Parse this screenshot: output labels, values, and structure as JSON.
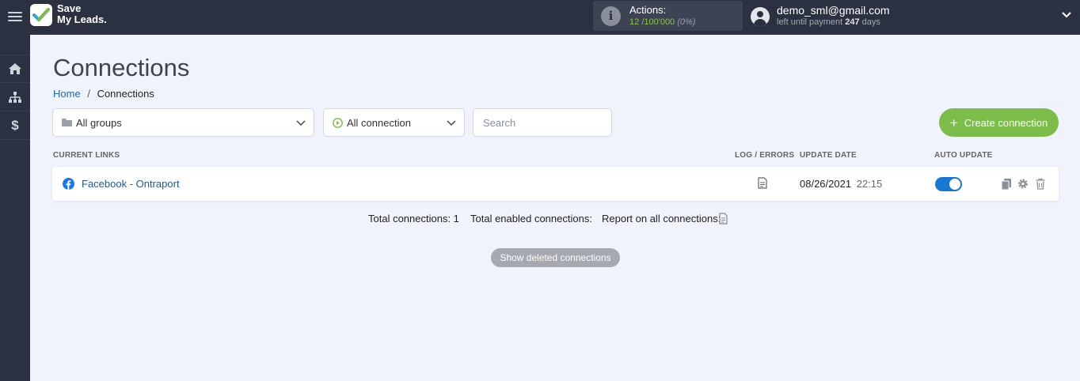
{
  "brand": {
    "line1": "Save",
    "line2": "My Leads."
  },
  "actions": {
    "label": "Actions:",
    "used": "12",
    "total": "/100'000",
    "percent": "(0%)"
  },
  "user": {
    "email": "demo_sml@gmail.com",
    "payment_prefix": "left until payment",
    "payment_days": "247",
    "payment_suffix": "days"
  },
  "sidebar": {
    "items": [
      {
        "icon": "home-icon"
      },
      {
        "icon": "sitemap-icon"
      },
      {
        "icon": "dollar-icon",
        "glyph": "$"
      }
    ]
  },
  "page": {
    "title": "Connections"
  },
  "breadcrumb": {
    "home": "Home",
    "separator": "/",
    "current": "Connections"
  },
  "filters": {
    "groups": "All groups",
    "connection": "All connection",
    "search_placeholder": "Search"
  },
  "create_button": {
    "label": "Create connection"
  },
  "table": {
    "headers": {
      "links": "CURRENT LINKS",
      "log": "LOG / ERRORS",
      "date": "UPDATE DATE",
      "auto": "AUTO UPDATE"
    },
    "rows": [
      {
        "name": "Facebook - Ontraport",
        "date": "08/26/2021",
        "time": "22:15",
        "auto_update": true
      }
    ]
  },
  "totals": {
    "connections": "Total connections: 1",
    "enabled": "Total enabled connections:",
    "report": "Report on all connections:"
  },
  "show_deleted": "Show deleted connections",
  "colors": {
    "topbar": "#2c3142",
    "accent_green": "#7cbd4a",
    "toggle_blue": "#1976d2",
    "link_blue": "#1f5a98"
  }
}
